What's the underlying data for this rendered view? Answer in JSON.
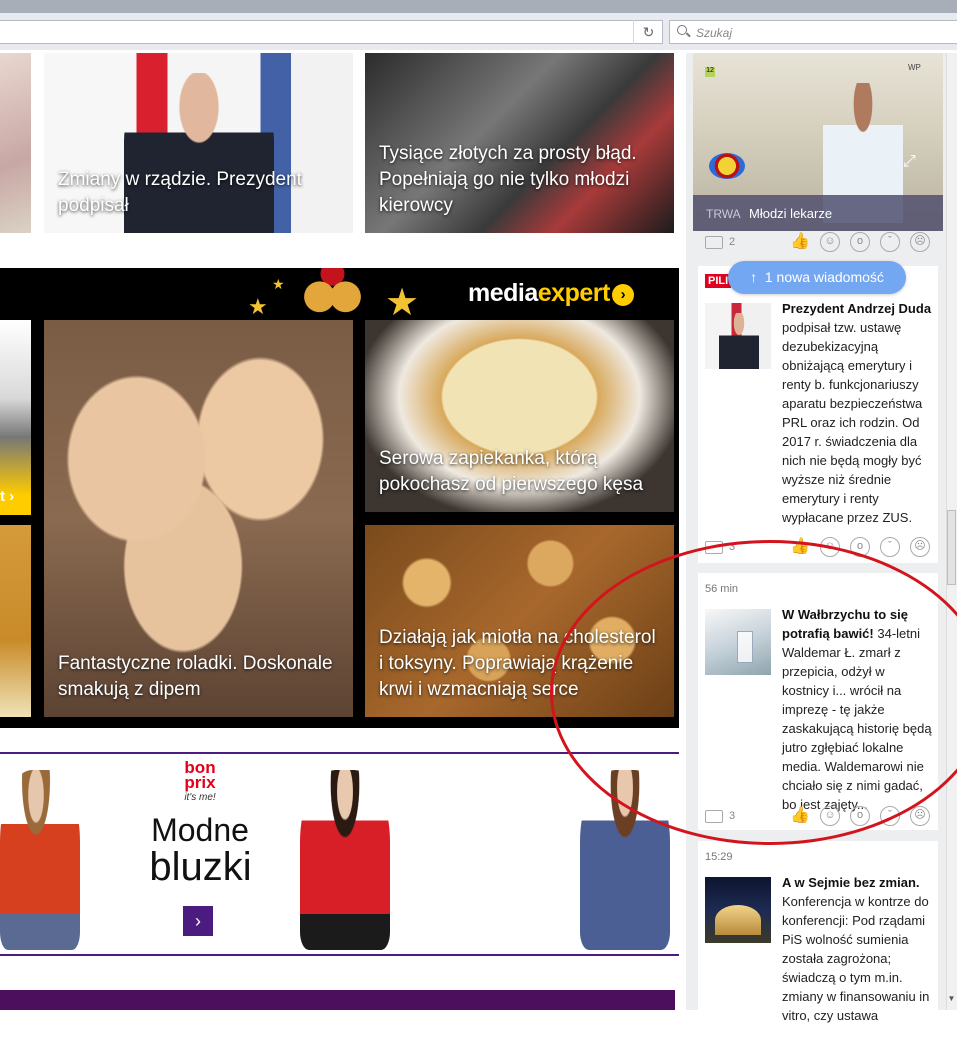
{
  "browser": {
    "search_placeholder": "Szukaj",
    "reload_glyph": "↻"
  },
  "tiles": {
    "president_caption": "Zmiany w rządzie. Prezydent podpisał",
    "fuel_caption": "Tysiące złotych za prosty błąd. Popełniają go nie tylko młodzi kierowcy"
  },
  "ad_mediaexpert": {
    "logo_white": "media",
    "logo_yellow": "expert",
    "logo_arrow": "›",
    "left_edge_text": "t ›",
    "tiles": [
      {
        "caption": "Fantastyczne roladki. Doskonale smakują z dipem"
      },
      {
        "caption": "Serowa zapiekanka, którą pokochasz od pierwszego kęsa"
      },
      {
        "caption": "Działają jak miotła na cholesterol i toksyny. Poprawiają krążenie krwi i wzmacniają serce"
      }
    ]
  },
  "ad_bonprix": {
    "logo_top": "bon",
    "logo_bottom": "prix",
    "logo_tag": "it's me!",
    "line1": "Modne",
    "line2": "bluzki",
    "button_glyph": "›"
  },
  "sidebar": {
    "video": {
      "status": "TRWA",
      "title": "Młodzi lekarze",
      "channel": "WP",
      "badge": "12"
    },
    "notification_pill": "1 nowa wiadomość",
    "feed": [
      {
        "tag": "PILI",
        "headline": "Prezydent Andrzej Duda",
        "body": " podpisał tzw. ustawę dezubekizacyjną obniżającą emerytury i renty b. funkcjonariuszy aparatu bezpieczeństwa PRL oraz ich rodzin. Od 2017 r. świadczenia dla nich nie będą mogły być wyższe niż średnie emerytury i renty wypłacane przez ZUS.",
        "comments": "3"
      },
      {
        "time": "56 min",
        "headline": "W Wałbrzychu to się potrafią bawić!",
        "body": " 34-letni Waldemar Ł. zmarł z przepicia, odżył w kostnicy i... wrócił na imprezę - tę jakże zaskakującą historię będą jutro zgłębiać lokalne media. Waldemarowi nie chciało się z nimi gadać, bo jest zajęty...",
        "comments": "3"
      },
      {
        "time": "15:29",
        "headline": "A w Sejmie bez zmian.",
        "body": " Konferencja w kontrze do konferencji:  Pod rządami PiS wolność sumienia została zagrożona; świadczą o tym m.in. zmiany w finansowaniu in vitro, czy ustawa"
      }
    ],
    "video_comments": "2"
  },
  "colors": {
    "mediaexpert_yellow": "#ffcc00",
    "bonprix_purple": "#4b1b7f",
    "pill_blue": "#74a7f2",
    "annotation_red": "#d4141c",
    "pili_red": "#e1001f"
  }
}
